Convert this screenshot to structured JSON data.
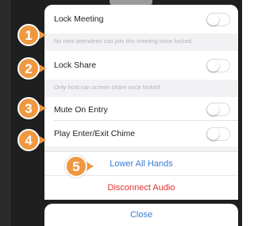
{
  "settings": {
    "lock_meeting": {
      "label": "Lock Meeting",
      "on": false
    },
    "lock_meeting_note": "No new attendees can join this meeting once locked.",
    "lock_share": {
      "label": "Lock Share",
      "on": false
    },
    "lock_share_note": "Only host can screen share once locked.",
    "mute_on_entry": {
      "label": "Mute On Entry",
      "on": false
    },
    "play_chime": {
      "label": "Play Enter/Exit Chime",
      "on": false
    }
  },
  "actions": {
    "lower_all_hands": "Lower All Hands",
    "disconnect_audio": "Disconnect Audio"
  },
  "close": {
    "label": "Close"
  },
  "callouts": [
    "1",
    "2",
    "3",
    "4",
    "5"
  ],
  "colors": {
    "accent_blue": "#3a7bd5",
    "destructive_red": "#e0322d",
    "callout_orange": "#ef9841"
  }
}
